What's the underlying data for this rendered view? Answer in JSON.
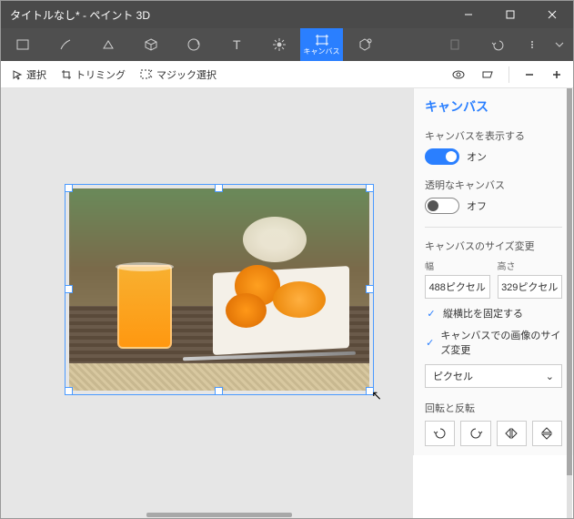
{
  "window": {
    "title": "タイトルなし* - ペイント 3D"
  },
  "ribbon": {
    "tools": [
      {
        "n": "menu"
      },
      {
        "n": "brushes"
      },
      {
        "n": "2d"
      },
      {
        "n": "3d"
      },
      {
        "n": "stickers"
      },
      {
        "n": "text"
      },
      {
        "n": "effects"
      },
      {
        "n": "canvas",
        "label": "キャンバス",
        "active": true
      },
      {
        "n": "3dlib"
      },
      {
        "n": "spacer"
      },
      {
        "n": "history",
        "disabled": true
      },
      {
        "n": "undo"
      },
      {
        "n": "dropdown"
      },
      {
        "n": "expand"
      }
    ]
  },
  "sub": {
    "select": "選択",
    "crop": "トリミング",
    "magic": "マジック選択"
  },
  "panel": {
    "title": "キャンバス",
    "showCanvasLabel": "キャンバスを表示する",
    "showCanvasValue": "オン",
    "transparentLabel": "透明なキャンバス",
    "transparentValue": "オフ",
    "resizeLabel": "キャンバスのサイズ変更",
    "widthLabel": "幅",
    "heightLabel": "高さ",
    "widthValue": "488ピクセル",
    "heightValue": "329ピクセル",
    "lockAspect": "縦横比を固定する",
    "resizeImage": "キャンバスでの画像のサイズ変更",
    "unit": "ピクセル",
    "rotateLabel": "回転と反転"
  }
}
